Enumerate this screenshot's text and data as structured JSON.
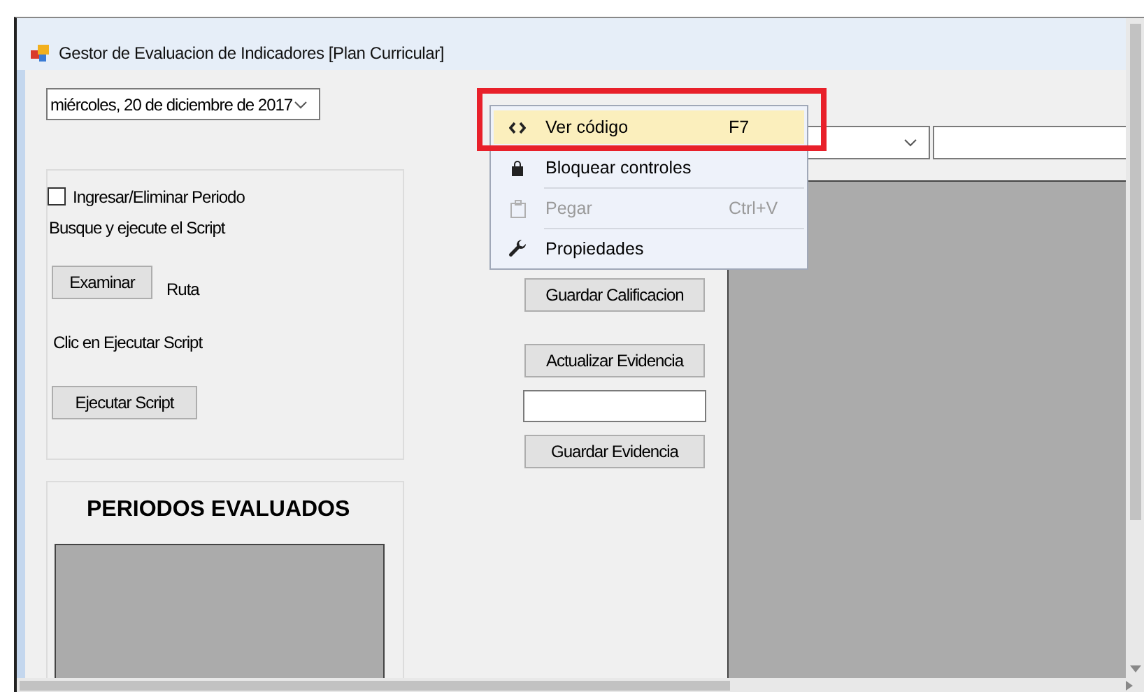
{
  "window": {
    "title": "Gestor de Evaluacion de Indicadores [Plan Curricular]"
  },
  "date_picker": {
    "value": "miércoles, 20 de  diciembre  de 2017"
  },
  "periodo_group": {
    "checkbox": {
      "label": "Ingresar/Eliminar Periodo",
      "checked": false
    },
    "instruction_1": "Busque y ejecute el Script",
    "browse_button": "Examinar",
    "path_label": "Ruta",
    "instruction_2": "Clic en Ejecutar Script",
    "run_button": "Ejecutar Script"
  },
  "periods_group": {
    "title": "PERIODOS EVALUADOS"
  },
  "middle_controls": [
    {
      "kind": "button",
      "label": "Guardar Calificacion"
    },
    {
      "kind": "button",
      "label": "Actualizar Evidencia"
    },
    {
      "kind": "textbox"
    },
    {
      "kind": "button",
      "label": "Guardar Evidencia"
    }
  ],
  "context_menu": {
    "items": [
      {
        "label": "Ver código",
        "shortcut": "F7",
        "selected": true,
        "disabled": false
      },
      {
        "label": "Bloquear controles",
        "selected": false,
        "disabled": false
      },
      {
        "label": "Pegar",
        "shortcut": "Ctrl+V",
        "selected": false,
        "disabled": true
      },
      {
        "label": "Propiedades",
        "selected": false,
        "disabled": false
      }
    ]
  }
}
